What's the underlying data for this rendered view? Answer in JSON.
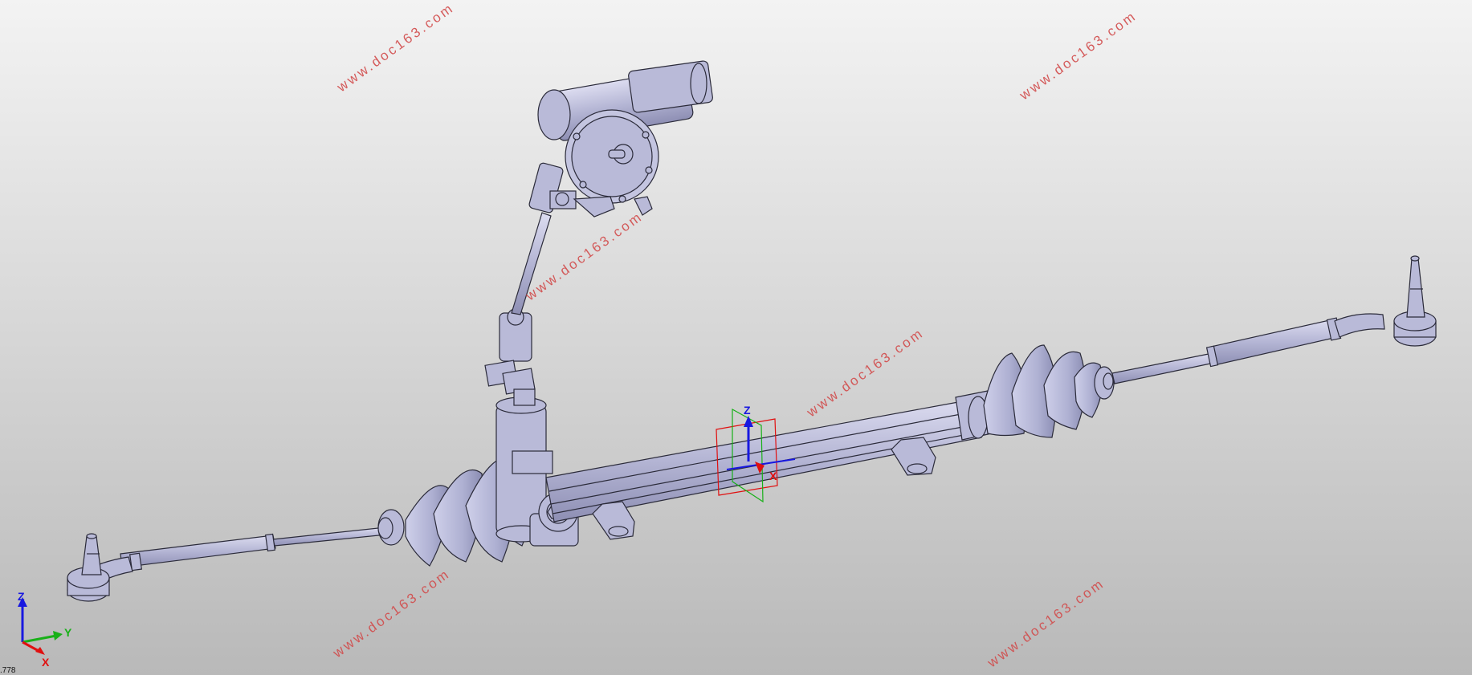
{
  "viewport": {
    "background_top": "#f3f3f3",
    "background_bottom": "#b9b9b9",
    "part_color": "#b9bad8",
    "edge_color": "#2b2b3a"
  },
  "watermarks": [
    "www.doc163.com",
    "www.doc163.com",
    "www.doc163.com",
    "www.doc163.com",
    "www.doc163.com",
    "www.doc163.com"
  ],
  "compass": {
    "z_label": "Z",
    "x_label": "X",
    "colors": {
      "x": "#e01010",
      "y": "#18b018",
      "z": "#1818e0"
    }
  },
  "axis_triad": {
    "z_label": "Z",
    "y_label": "Y",
    "x_label": "X"
  },
  "status": {
    "text": ".778"
  }
}
